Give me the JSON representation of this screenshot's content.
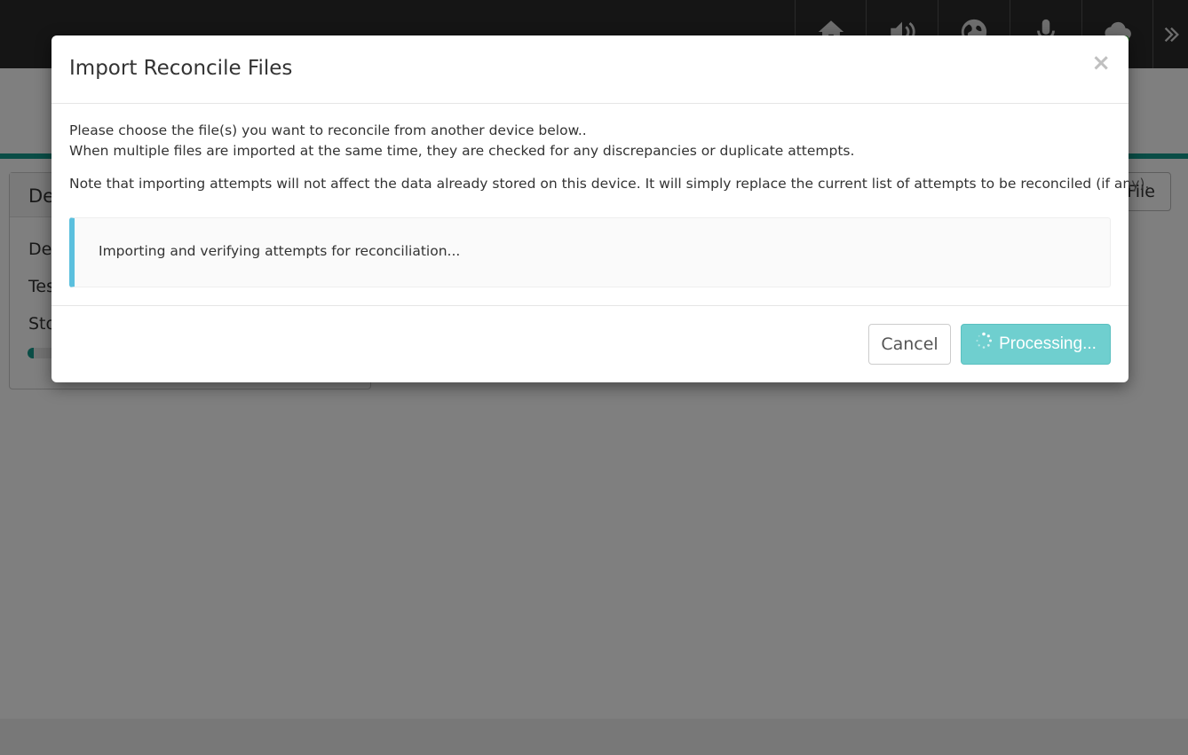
{
  "background": {
    "panel": {
      "title_fragment": "De",
      "rows": [
        "De",
        "Tes",
        "Sto"
      ],
      "storage_fraction": 0.02
    },
    "file_button_label": "File",
    "toolbar_icons": [
      "home-icon",
      "volume-icon",
      "globe-icon",
      "microphone-icon",
      "cloud-icon",
      "double-chevron-right-icon"
    ]
  },
  "modal": {
    "title": "Import Reconcile Files",
    "close_label": "×",
    "line1": "Please choose the file(s) you want to reconcile from another device below..",
    "line2": "When multiple files are imported at the same time, they are checked for any discrepancies or duplicate attempts.",
    "note": "Note that importing attempts will not affect the data already stored on this device. It will simply replace the current list of attempts to be reconciled (if any).",
    "status": "Importing and verifying attempts for reconciliation...",
    "cancel_label": "Cancel",
    "processing_label": "Processing..."
  },
  "colors": {
    "accent_teal": "#159a8c",
    "processing_button": "#6fcfcf",
    "callout_border": "#5bc0de"
  }
}
